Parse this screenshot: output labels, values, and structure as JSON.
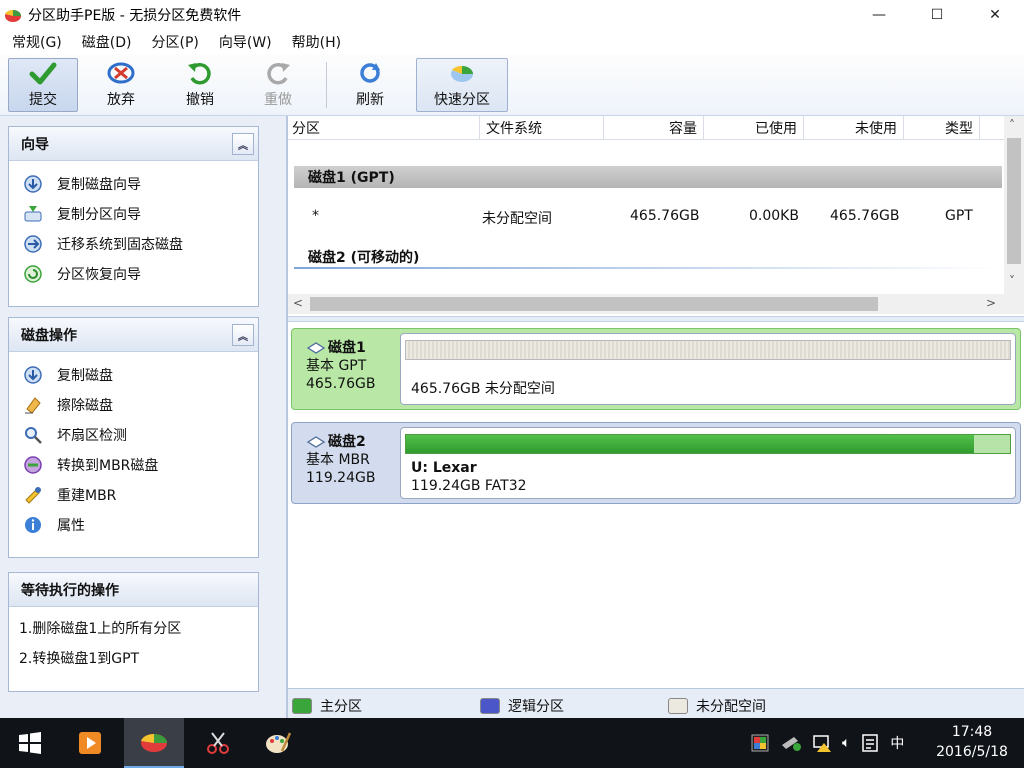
{
  "window": {
    "title": "分区助手PE版 - 无损分区免费软件",
    "controls": [
      "—",
      "☐",
      "✕"
    ]
  },
  "menu": [
    "常规(G)",
    "磁盘(D)",
    "分区(P)",
    "向导(W)",
    "帮助(H)"
  ],
  "toolbar": {
    "commit": "提交",
    "discard": "放弃",
    "undo": "撤销",
    "redo": "重做",
    "refresh": "刷新",
    "quick_partition": "快速分区"
  },
  "wizard_panel": {
    "title": "向导",
    "items": [
      "复制磁盘向导",
      "复制分区向导",
      "迁移系统到固态磁盘",
      "分区恢复向导"
    ]
  },
  "disk_ops_panel": {
    "title": "磁盘操作",
    "items": [
      "复制磁盘",
      "擦除磁盘",
      "坏扇区检测",
      "转换到MBR磁盘",
      "重建MBR",
      "属性"
    ]
  },
  "pending_panel": {
    "title": "等待执行的操作",
    "items": [
      "1.删除磁盘1上的所有分区",
      "2.转换磁盘1到GPT"
    ]
  },
  "table": {
    "headers": [
      "分区",
      "文件系统",
      "容量",
      "已使用",
      "未使用",
      "类型"
    ],
    "disk1_label": "磁盘1 (GPT)",
    "disk1_rows": [
      {
        "partition": "*",
        "fs": "未分配空间",
        "capacity": "465.76GB",
        "used": "0.00KB",
        "free": "465.76GB",
        "type": "GPT"
      }
    ],
    "disk2_label": "磁盘2 (可移动的)"
  },
  "disk_map": {
    "disk1": {
      "name": "磁盘1",
      "type": "基本 GPT",
      "size": "465.76GB",
      "partition_text": "465.76GB 未分配空间"
    },
    "disk2": {
      "name": "磁盘2",
      "type": "基本 MBR",
      "size": "119.24GB",
      "partition_label": "U: Lexar",
      "partition_text": "119.24GB FAT32",
      "used_fraction": 0.94
    }
  },
  "legend": [
    "主分区",
    "逻辑分区",
    "未分配空间"
  ],
  "colors": {
    "primary": "#3aa53a",
    "logical": "#4b57c8",
    "unallocated": "#ece9e0",
    "disk1_bg": "#b9e8a6",
    "disk2_bg": "#d3dcee"
  },
  "taskbar": {
    "time": "17:48",
    "date": "2016/5/18",
    "ime": "中"
  }
}
